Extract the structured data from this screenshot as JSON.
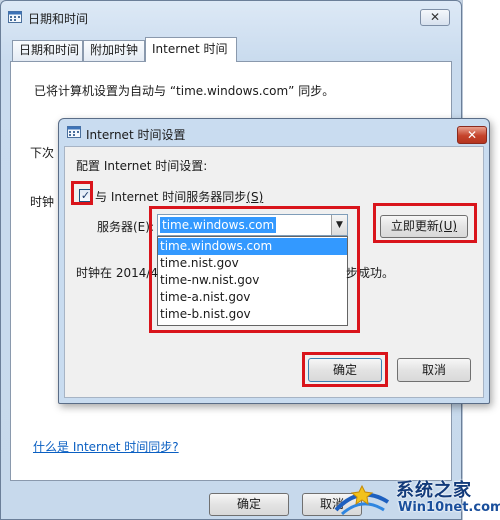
{
  "outer": {
    "title": "日期和时间",
    "close_label": "✕",
    "tabs": [
      "日期和时间",
      "附加时钟",
      "Internet 时间"
    ],
    "status_text": "已将计算机设置为自动与 “time.windows.com” 同步。",
    "partial_next": "下次",
    "partial_clock": "时钟",
    "help_link": "什么是 Internet 时间同步?",
    "ok_label": "确定",
    "cancel_label": "取消"
  },
  "dialog": {
    "title": "Internet 时间设置",
    "close_label": "✕",
    "config_label": "配置 Internet 时间设置:",
    "sync_checked": true,
    "sync_label": "与 Internet 时间服务器同步",
    "sync_accel": "(S)",
    "server_label": "服务器(E):",
    "server_value": "time.windows.com",
    "server_options": [
      "time.windows.com",
      "time.nist.gov",
      "time-nw.nist.gov",
      "time-a.nist.gov",
      "time-b.nist.gov"
    ],
    "update_label": "立即更新",
    "update_accel": "(U)",
    "clock_text_left": "时钟在 2014/4",
    "clock_text_right": "步成功。",
    "ok_label": "确定",
    "cancel_label": "取消"
  },
  "watermark": {
    "line1": "系统之家",
    "line2": "Win10net.com"
  },
  "colors": {
    "annotation": "#d9141b",
    "selection": "#3399ff",
    "link": "#0a5fc2"
  }
}
